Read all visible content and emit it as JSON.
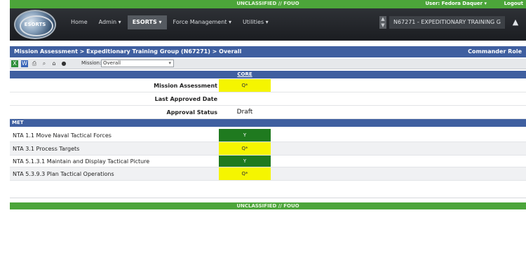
{
  "classification": {
    "banner": "UNCLASSIFIED // FOUO",
    "footer_banner": "UNCLASSIFIED // FOUO"
  },
  "top": {
    "user": "User: Fedora Daquer ▾",
    "logout": "Logout"
  },
  "logo": {
    "text": "ESORTS"
  },
  "nav": {
    "items": [
      {
        "label": "Home"
      },
      {
        "label": "Admin ▾"
      },
      {
        "label": "ESORTS ▾"
      },
      {
        "label": "Force Management ▾"
      },
      {
        "label": "Utilities ▾"
      }
    ]
  },
  "unit_selector": {
    "value": "N67271 - EXPEDITIONARY TRAINING G"
  },
  "breadcrumb": {
    "path": "Mission Assessment > Expeditionary Training Group (N67271) > Overall",
    "role": "Commander Role"
  },
  "toolbar": {
    "mission_label": "Mission:",
    "mission_value": "Overall",
    "icons": [
      "excel-icon",
      "word-icon",
      "print-icon",
      "search-icon",
      "home-icon",
      "binoculars-icon"
    ]
  },
  "core": {
    "header": "CORE",
    "rows": [
      {
        "label": "Mission Assessment",
        "value": "Q*",
        "status": "yellow"
      },
      {
        "label": "Last Approved Date",
        "value": "",
        "status": "none"
      },
      {
        "label": "Approval Status",
        "value": "Draft",
        "status": "text"
      }
    ]
  },
  "met": {
    "header": "MET",
    "rows": [
      {
        "label": "NTA 1.1 Move Naval Tactical Forces",
        "value": "Y",
        "status": "green"
      },
      {
        "label": "NTA 3.1 Process Targets",
        "value": "Q*",
        "status": "yellow"
      },
      {
        "label": "NTA 5.1.3.1 Maintain and Display Tactical Picture",
        "value": "Y",
        "status": "green"
      },
      {
        "label": "NTA 5.3.9.3 Plan Tactical Operations",
        "value": "Q*",
        "status": "yellow"
      }
    ]
  },
  "colors": {
    "green": "#1f7a1f",
    "yellow": "#f5f500",
    "header_blue": "#3f5fa0",
    "class_green": "#4ca53a"
  }
}
